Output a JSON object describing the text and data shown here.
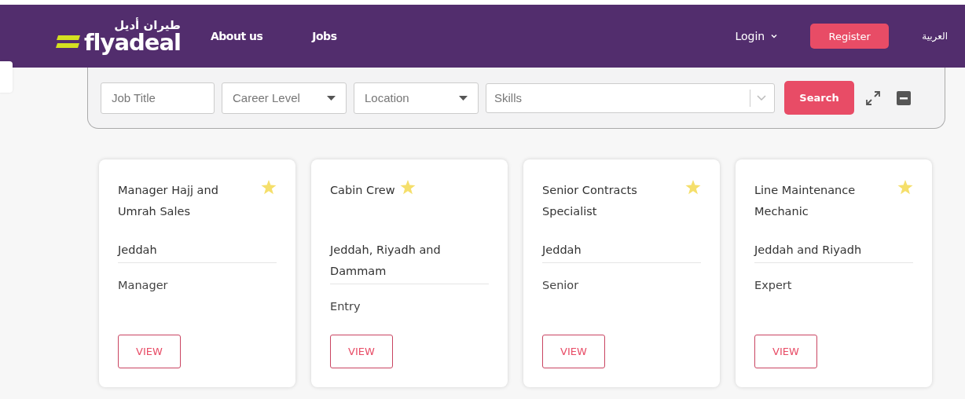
{
  "header": {
    "logo": {
      "arabic": "طيران أديل",
      "latin": "flyadeal"
    },
    "nav": [
      "About us",
      "Jobs"
    ],
    "login": "Login",
    "register": "Register",
    "language": "العربية"
  },
  "search": {
    "fields": [
      {
        "kind": "text",
        "placeholder": "Job Title"
      },
      {
        "kind": "select",
        "placeholder": "Career Level"
      },
      {
        "kind": "select",
        "placeholder": "Location"
      },
      {
        "kind": "multi",
        "placeholder": "Skills"
      }
    ],
    "button": "Search"
  },
  "jobs": [
    {
      "title": "Manager Hajj and Umrah Sales",
      "location": "Jeddah",
      "level": "Manager",
      "button": "VIEW"
    },
    {
      "title": "Cabin Crew",
      "location": "Jeddah, Riyadh and Dammam",
      "level": "Entry",
      "button": "VIEW"
    },
    {
      "title": "Senior Contracts Specialist",
      "location": "Jeddah",
      "level": "Senior",
      "button": "VIEW"
    },
    {
      "title": "Line Maintenance Mechanic",
      "location": "Jeddah and Riyadh",
      "level": "Expert",
      "button": "VIEW"
    }
  ]
}
